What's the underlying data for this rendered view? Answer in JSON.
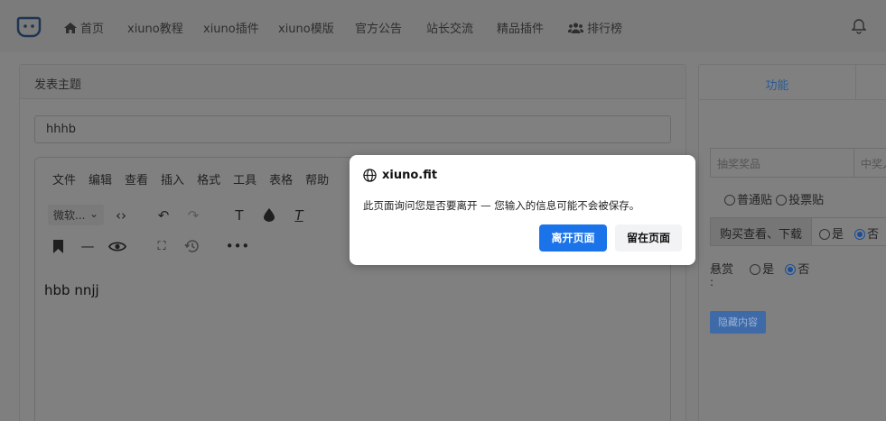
{
  "nav": {
    "items": [
      {
        "label": "首页",
        "icon": "home-icon"
      },
      {
        "label": "xiuno教程"
      },
      {
        "label": "xiuno插件"
      },
      {
        "label": "xiuno模版"
      },
      {
        "label": "官方公告"
      },
      {
        "label": "站长交流"
      },
      {
        "label": "精品插件"
      },
      {
        "label": "排行榜",
        "icon": "users-icon"
      }
    ]
  },
  "main": {
    "header": "发表主题",
    "title_value": "hhhb",
    "editor": {
      "menu": [
        "文件",
        "编辑",
        "查看",
        "插入",
        "格式",
        "工具",
        "表格",
        "帮助"
      ],
      "font_select": "微软...",
      "content": "hbb nnjj"
    }
  },
  "side": {
    "tabs": [
      "功能"
    ],
    "prize_placeholder": "抽奖奖品",
    "winner_placeholder": "中奖人",
    "post_types": [
      "普通贴",
      "投票贴"
    ],
    "buy_label": "购买查看、下载",
    "yes": "是",
    "no": "否",
    "reward_label": "悬赏",
    "reward_colon": ":",
    "hide_button": "隐藏内容"
  },
  "dialog": {
    "site": "xiuno.fit",
    "message": "此页面询问您是否要离开 — 您输入的信息可能不会被保存。",
    "leave_label": "离开页面",
    "stay_label": "留在页面"
  },
  "colors": {
    "primary": "#1a73e8",
    "overlay": "#7f7f7f"
  }
}
